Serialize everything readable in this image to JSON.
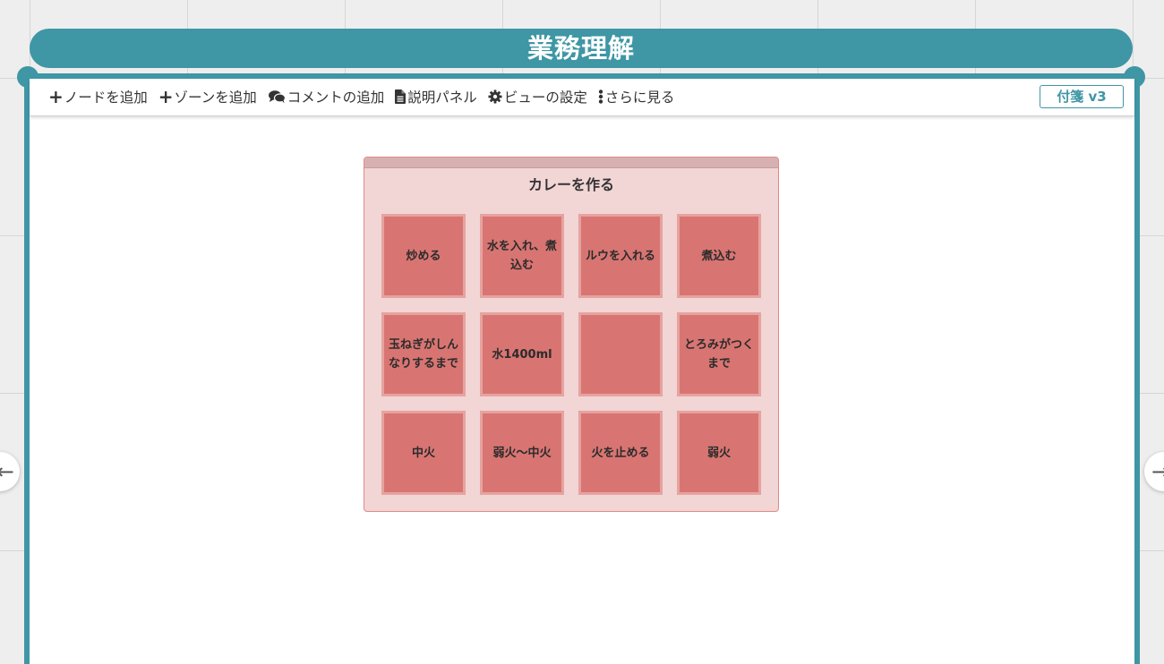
{
  "header": {
    "title": "業務理解"
  },
  "toolbar": {
    "items": [
      {
        "icon": "plus-icon",
        "label": "ノードを追加"
      },
      {
        "icon": "plus-icon",
        "label": "ゾーンを追加"
      },
      {
        "icon": "comments-icon",
        "label": "コメントの追加"
      },
      {
        "icon": "document-icon",
        "label": "説明パネル"
      },
      {
        "icon": "gear-icon",
        "label": "ビューの設定"
      },
      {
        "icon": "vertical-dots-icon",
        "label": "さらに見る"
      }
    ],
    "version_badge": "付箋 v3"
  },
  "zone": {
    "title": "カレーを作る",
    "stickies": [
      [
        "炒める",
        "水を入れ、煮込む",
        "ルウを入れる",
        "煮込む"
      ],
      [
        "玉ねぎがしんなりするまで",
        "水1400ml",
        "",
        "とろみがつくまで"
      ],
      [
        "中火",
        "弱火〜中火",
        "火を止める",
        "弱火"
      ]
    ]
  },
  "colors": {
    "accent": "#3f96a5",
    "zone_background": "#f2d5d5",
    "zone_border": "#e08a86",
    "sticky_fill": "#d87572",
    "sticky_border": "#e6a3a0"
  }
}
